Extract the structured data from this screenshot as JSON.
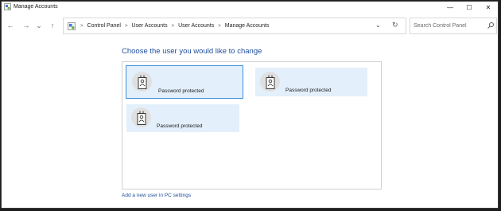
{
  "window": {
    "title": "Manage Accounts"
  },
  "window_controls": {
    "minimize": "—",
    "maximize": "☐",
    "close": "✕"
  },
  "nav": {
    "back": "←",
    "forward": "→",
    "history": "⌄",
    "up": "↑"
  },
  "breadcrumb": {
    "separator": ">",
    "items": [
      "Control Panel",
      "User Accounts",
      "User Accounts",
      "Manage Accounts"
    ]
  },
  "address": {
    "dropdown": "⌄",
    "refresh": "↻"
  },
  "search": {
    "placeholder": "Search Control Panel"
  },
  "main": {
    "heading": "Choose the user you would like to change",
    "accounts": [
      {
        "status": "Password protected",
        "selected": true
      },
      {
        "status": "Password protected",
        "selected": false
      },
      {
        "status": "Password protected",
        "selected": false
      }
    ],
    "add_user_link": "Add a new user in PC settings"
  },
  "colors": {
    "accent": "#1e4e9c",
    "tile": "#e3f0fb",
    "selected_border": "#3d8ee0"
  }
}
